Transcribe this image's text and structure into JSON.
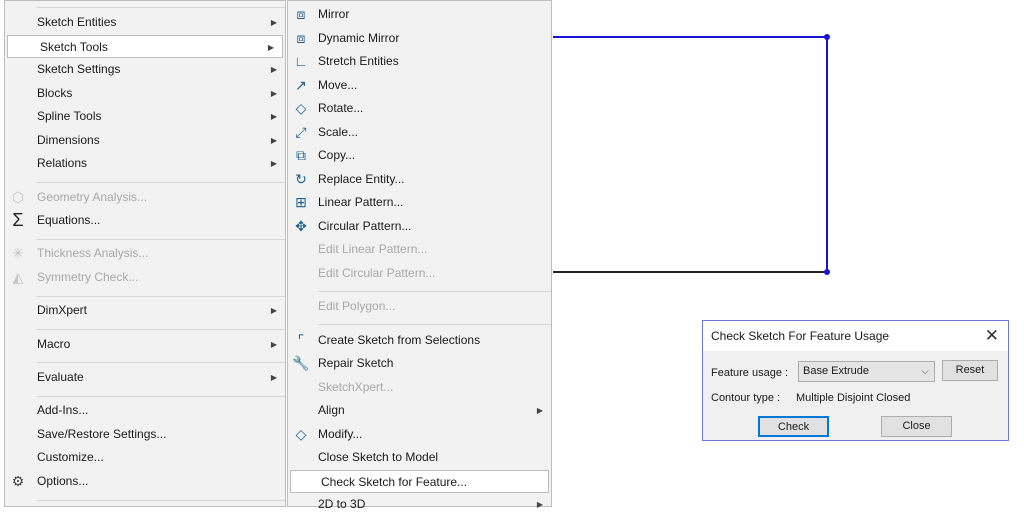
{
  "main_menu": [
    {
      "label": "Sketch Entities",
      "sub": true
    },
    {
      "label": "Sketch Tools",
      "sub": true,
      "highlighted": true
    },
    {
      "label": "Sketch Settings",
      "sub": true
    },
    {
      "label": "Blocks",
      "sub": true
    },
    {
      "label": "Spline Tools",
      "sub": true
    },
    {
      "label": "Dimensions",
      "sub": true
    },
    {
      "label": "Relations",
      "sub": true
    },
    {
      "label": "Geometry Analysis...",
      "disabled": true,
      "icon": "geometry-analysis-icon"
    },
    {
      "label": "Equations...",
      "icon": "sigma-icon"
    },
    {
      "label": "Thickness Analysis...",
      "disabled": true,
      "icon": "thickness-analysis-icon"
    },
    {
      "label": "Symmetry Check...",
      "disabled": true,
      "icon": "symmetry-check-icon"
    },
    {
      "label": "DimXpert",
      "sub": true
    },
    {
      "label": "Macro",
      "sub": true
    },
    {
      "label": "Evaluate",
      "sub": true
    },
    {
      "label": "Add-Ins..."
    },
    {
      "label": "Save/Restore Settings..."
    },
    {
      "label": "Customize..."
    },
    {
      "label": "Options...",
      "icon": "gear-icon"
    }
  ],
  "sketch_tools_menu": [
    {
      "label": "Mirror",
      "icon": "mirror-icon"
    },
    {
      "label": "Dynamic Mirror",
      "icon": "dynamic-mirror-icon"
    },
    {
      "label": "Stretch Entities",
      "icon": "stretch-icon"
    },
    {
      "label": "Move...",
      "icon": "move-icon"
    },
    {
      "label": "Rotate...",
      "icon": "rotate-icon"
    },
    {
      "label": "Scale...",
      "icon": "scale-icon"
    },
    {
      "label": "Copy...",
      "icon": "copy-icon"
    },
    {
      "label": "Replace Entity...",
      "icon": "replace-entity-icon"
    },
    {
      "label": "Linear Pattern...",
      "icon": "linear-pattern-icon"
    },
    {
      "label": "Circular Pattern...",
      "icon": "circular-pattern-icon"
    },
    {
      "label": "Edit Linear Pattern...",
      "disabled": true
    },
    {
      "label": "Edit Circular Pattern...",
      "disabled": true
    },
    {
      "label": "Edit Polygon...",
      "disabled": true
    },
    {
      "label": "Create Sketch from Selections",
      "icon": "create-sketch-icon"
    },
    {
      "label": "Repair Sketch",
      "icon": "repair-sketch-icon"
    },
    {
      "label": "SketchXpert...",
      "disabled": true
    },
    {
      "label": "Align",
      "sub": true
    },
    {
      "label": "Modify...",
      "icon": "modify-icon"
    },
    {
      "label": "Close Sketch to Model"
    },
    {
      "label": "Check Sketch for Feature...",
      "highlighted": true
    },
    {
      "label": "2D to 3D",
      "sub": true
    }
  ],
  "dialog": {
    "title": "Check Sketch For Feature Usage",
    "feature_usage_label": "Feature usage :",
    "feature_usage_value": "Base Extrude",
    "reset": "Reset",
    "contour_type_label": "Contour type :",
    "contour_type_value": "Multiple Disjoint Closed",
    "check": "Check",
    "close": "Close"
  },
  "colors": {
    "sketch_line": "#1010d0",
    "accent": "#0078d7"
  }
}
